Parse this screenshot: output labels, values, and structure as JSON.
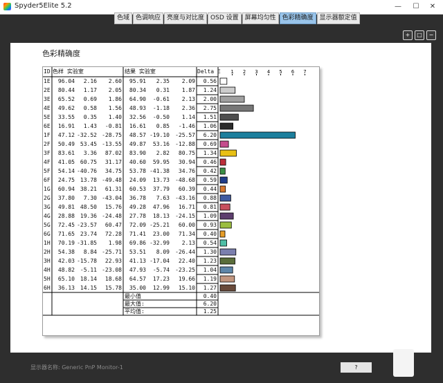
{
  "window": {
    "title": "Spyder5Elite 5.2",
    "controls": [
      "—",
      "☐",
      "✕"
    ]
  },
  "tabs": [
    {
      "label": "色域",
      "active": false
    },
    {
      "label": "色调响应",
      "active": false
    },
    {
      "label": "亮度与对比度",
      "active": false
    },
    {
      "label": "OSD 设置",
      "active": false
    },
    {
      "label": "屏幕均匀性",
      "active": false
    },
    {
      "label": "色彩精确度",
      "active": true
    },
    {
      "label": "显示器额定值",
      "active": false
    }
  ],
  "report": {
    "title": "色彩精确度",
    "headers": {
      "id": "ID",
      "sample": "色样 实验室",
      "result": "结果 实验室",
      "delta": "Delta E"
    },
    "scale": [
      1,
      2,
      3,
      4,
      5,
      6,
      7
    ],
    "rows": [
      {
        "id": "1E",
        "s": [
          "96.04",
          "2.16",
          "2.60"
        ],
        "r": [
          "95.91",
          "2.35",
          "2.09"
        ],
        "d": "0.56",
        "color": "#ffffff"
      },
      {
        "id": "2E",
        "s": [
          "80.44",
          "1.17",
          "2.05"
        ],
        "r": [
          "80.34",
          "0.31",
          "1.87"
        ],
        "d": "1.24",
        "color": "#cccccc"
      },
      {
        "id": "3E",
        "s": [
          "65.52",
          "0.69",
          "1.86"
        ],
        "r": [
          "64.90",
          "-0.61",
          "2.13"
        ],
        "d": "2.00",
        "color": "#a0a0a0"
      },
      {
        "id": "4E",
        "s": [
          "49.62",
          "0.58",
          "1.56"
        ],
        "r": [
          "48.93",
          "-1.18",
          "2.36"
        ],
        "d": "2.75",
        "color": "#777777"
      },
      {
        "id": "5E",
        "s": [
          "33.55",
          "0.35",
          "1.40"
        ],
        "r": [
          "32.56",
          "-0.50",
          "1.14"
        ],
        "d": "1.51",
        "color": "#4f4f4f"
      },
      {
        "id": "6E",
        "s": [
          "16.91",
          "1.43",
          "-0.81"
        ],
        "r": [
          "16.61",
          "0.85",
          "-1.46"
        ],
        "d": "1.06",
        "color": "#2b2b2b"
      },
      {
        "id": "1F",
        "s": [
          "47.12",
          "-32.52",
          "-28.75"
        ],
        "r": [
          "48.57",
          "-19.10",
          "-25.57"
        ],
        "d": "6.20",
        "color": "#1c7f9d"
      },
      {
        "id": "2F",
        "s": [
          "50.49",
          "53.45",
          "-13.55"
        ],
        "r": [
          "49.87",
          "53.16",
          "-12.88"
        ],
        "d": "0.69",
        "color": "#c44c8d"
      },
      {
        "id": "3F",
        "s": [
          "83.61",
          "3.36",
          "87.02"
        ],
        "r": [
          "83.90",
          "2.82",
          "80.75"
        ],
        "d": "1.34",
        "color": "#e8c015"
      },
      {
        "id": "4F",
        "s": [
          "41.05",
          "60.75",
          "31.17"
        ],
        "r": [
          "40.60",
          "59.95",
          "30.94"
        ],
        "d": "0.46",
        "color": "#bc2f3a"
      },
      {
        "id": "5F",
        "s": [
          "54.14",
          "-40.76",
          "34.75"
        ],
        "r": [
          "53.78",
          "-41.38",
          "34.76"
        ],
        "d": "0.42",
        "color": "#3b8f46"
      },
      {
        "id": "6F",
        "s": [
          "24.75",
          "13.78",
          "-49.48"
        ],
        "r": [
          "24.09",
          "13.73",
          "-48.68"
        ],
        "d": "0.59",
        "color": "#1e3c8a"
      },
      {
        "id": "1G",
        "s": [
          "60.94",
          "38.21",
          "61.31"
        ],
        "r": [
          "60.53",
          "37.79",
          "60.39"
        ],
        "d": "0.44",
        "color": "#d7772e"
      },
      {
        "id": "2G",
        "s": [
          "37.80",
          "7.30",
          "-43.04"
        ],
        "r": [
          "36.78",
          "7.63",
          "-43.16"
        ],
        "d": "0.88",
        "color": "#3f5aa0"
      },
      {
        "id": "3G",
        "s": [
          "49.81",
          "48.50",
          "15.76"
        ],
        "r": [
          "49.28",
          "47.96",
          "16.71"
        ],
        "d": "0.81",
        "color": "#c8505e"
      },
      {
        "id": "4G",
        "s": [
          "28.88",
          "19.36",
          "-24.48"
        ],
        "r": [
          "27.78",
          "18.13",
          "-24.15"
        ],
        "d": "1.09",
        "color": "#5d3e6e"
      },
      {
        "id": "5G",
        "s": [
          "72.45",
          "-23.57",
          "60.47"
        ],
        "r": [
          "72.09",
          "-25.21",
          "60.00"
        ],
        "d": "0.93",
        "color": "#9bbd3f"
      },
      {
        "id": "6G",
        "s": [
          "71.65",
          "23.74",
          "72.28"
        ],
        "r": [
          "71.41",
          "23.00",
          "71.34"
        ],
        "d": "0.40",
        "color": "#e69d28"
      },
      {
        "id": "1H",
        "s": [
          "70.19",
          "-31.85",
          "1.98"
        ],
        "r": [
          "69.86",
          "-32.99",
          "2.13"
        ],
        "d": "0.54",
        "color": "#4fbea6"
      },
      {
        "id": "2H",
        "s": [
          "54.38",
          "8.84",
          "-25.71"
        ],
        "r": [
          "53.51",
          "8.09",
          "-26.44"
        ],
        "d": "1.30",
        "color": "#7b7fae"
      },
      {
        "id": "3H",
        "s": [
          "42.03",
          "-15.78",
          "22.93"
        ],
        "r": [
          "41.13",
          "-17.04",
          "22.40"
        ],
        "d": "1.23",
        "color": "#5a6d3a"
      },
      {
        "id": "4H",
        "s": [
          "48.82",
          "-5.11",
          "-23.08"
        ],
        "r": [
          "47.93",
          "-5.74",
          "-23.25"
        ],
        "d": "1.04",
        "color": "#5e86a9"
      },
      {
        "id": "5H",
        "s": [
          "65.10",
          "18.14",
          "18.68"
        ],
        "r": [
          "64.57",
          "17.23",
          "19.66"
        ],
        "d": "1.19",
        "color": "#c2967f"
      },
      {
        "id": "6H",
        "s": [
          "36.13",
          "14.15",
          "15.78"
        ],
        "r": [
          "35.00",
          "12.99",
          "15.10"
        ],
        "d": "1.27",
        "color": "#694a3a"
      }
    ],
    "summary": [
      {
        "label": "最小值",
        "value": "0.40"
      },
      {
        "label": "最大值:",
        "value": "6.20"
      },
      {
        "label": "平均值:",
        "value": "1.25"
      }
    ]
  },
  "footer": {
    "label": "显示器名称: Generic PnP Monitor-1",
    "button": "?"
  },
  "zoom_icons": [
    "zoom-in-icon",
    "zoom-fit-icon",
    "zoom-out-icon"
  ]
}
